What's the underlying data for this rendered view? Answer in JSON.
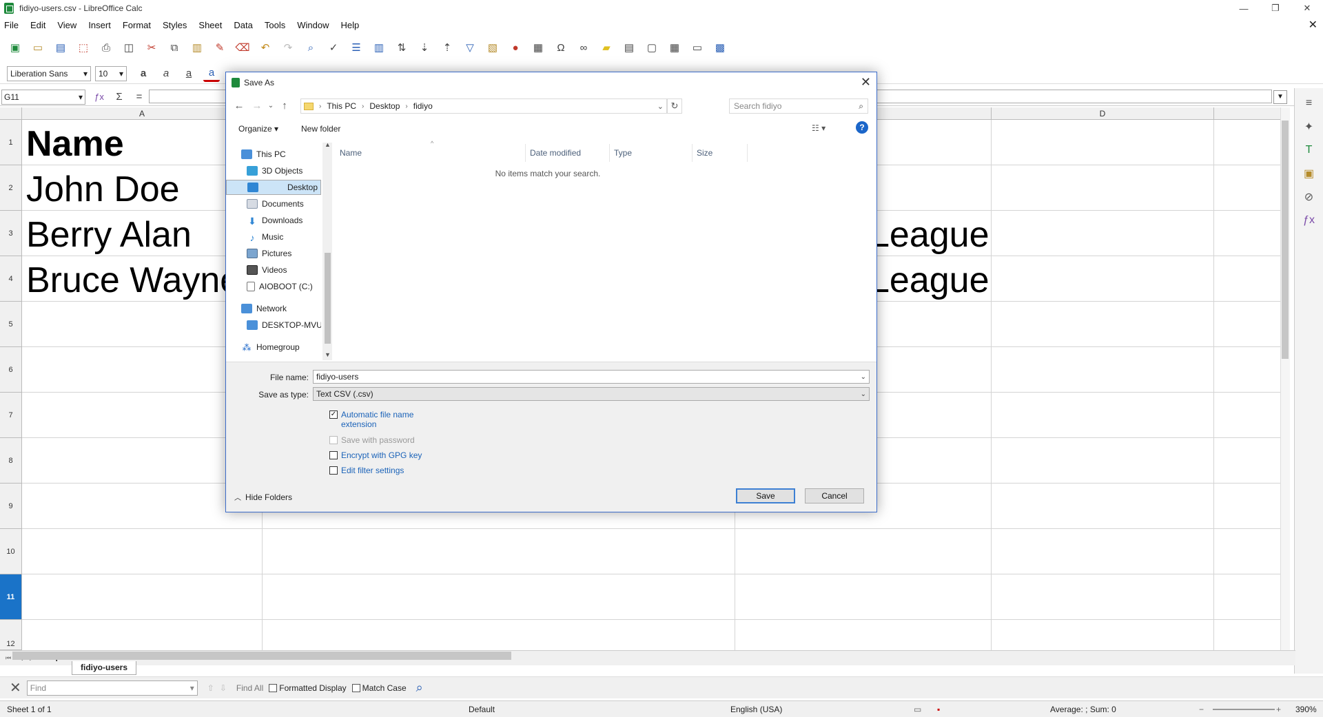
{
  "window": {
    "title": "fidiyo-users.csv - LibreOffice Calc"
  },
  "menu": [
    "File",
    "Edit",
    "View",
    "Insert",
    "Format",
    "Styles",
    "Sheet",
    "Data",
    "Tools",
    "Window",
    "Help"
  ],
  "format_bar": {
    "font_name": "Liberation Sans",
    "font_size": "10"
  },
  "formula_bar": {
    "cell_ref": "G11"
  },
  "columns": {
    "a": "A",
    "d": "D"
  },
  "rows": [
    "1",
    "2",
    "3",
    "4",
    "5",
    "6",
    "7",
    "8",
    "9",
    "10",
    "11",
    "12"
  ],
  "cells": {
    "a1": "Name",
    "a2": "John Doe",
    "a3": "Berry Alan",
    "a4": "Bruce Wayne",
    "c3_tail": "League",
    "c4_tail": "League"
  },
  "sheet_tab": "fidiyo-users",
  "find_bar": {
    "placeholder": "Find",
    "find_all": "Find All",
    "formatted_display": "Formatted Display",
    "match_case": "Match Case"
  },
  "status": {
    "sheet": "Sheet 1 of 1",
    "style": "Default",
    "language": "English (USA)",
    "summary": "Average: ; Sum: 0",
    "zoom": "390%"
  },
  "dialog": {
    "title": "Save As",
    "breadcrumb": [
      "This PC",
      "Desktop",
      "fidiyo"
    ],
    "search_placeholder": "Search fidiyo",
    "organize": "Organize",
    "new_folder": "New folder",
    "nav_items": [
      "This PC",
      "3D Objects",
      "Desktop",
      "Documents",
      "Downloads",
      "Music",
      "Pictures",
      "Videos",
      "AIOBOOT (C:)",
      "Network",
      "DESKTOP-MVUT",
      "Homegroup"
    ],
    "columns": [
      "Name",
      "Date modified",
      "Type",
      "Size"
    ],
    "empty_message": "No items match your search.",
    "file_name_label": "File name:",
    "file_name": "fidiyo-users",
    "save_type_label": "Save as type:",
    "save_type": "Text CSV (.csv)",
    "options": {
      "auto_ext_1": "Automatic file name",
      "auto_ext_2": "extension",
      "password": "Save with password",
      "gpg": "Encrypt with GPG key",
      "filter": "Edit filter settings"
    },
    "hide_folders": "Hide Folders",
    "save": "Save",
    "cancel": "Cancel"
  }
}
